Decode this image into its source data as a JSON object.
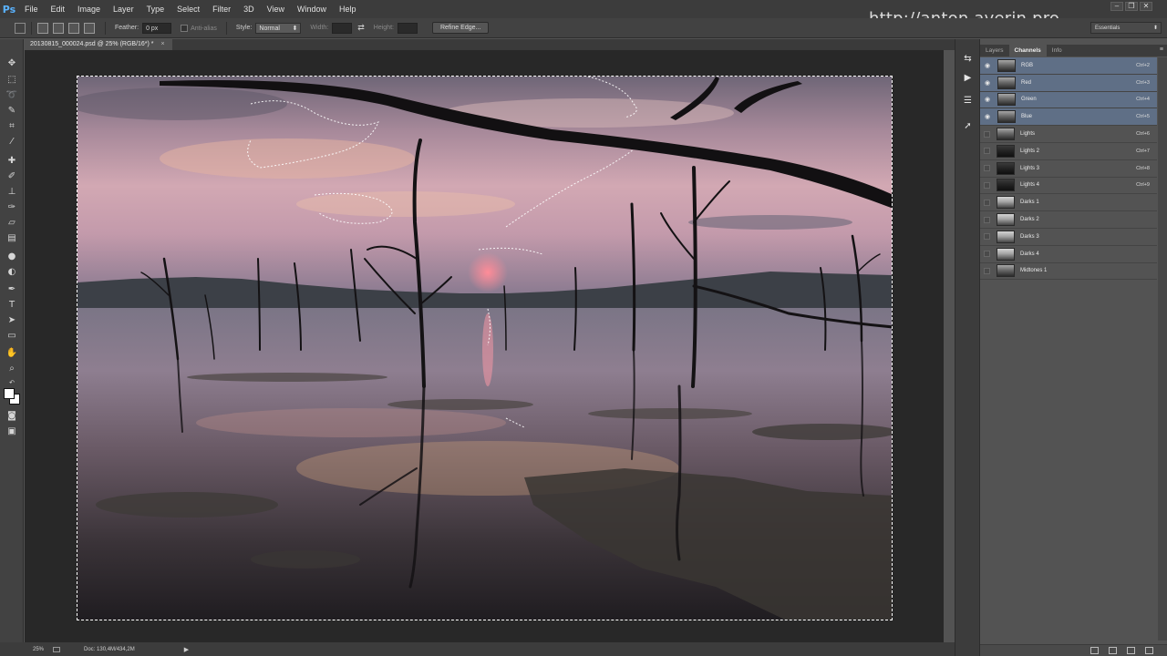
{
  "menubar": {
    "logo": "Ps",
    "items": [
      "File",
      "Edit",
      "Image",
      "Layer",
      "Type",
      "Select",
      "Filter",
      "3D",
      "View",
      "Window",
      "Help"
    ],
    "watermark": "http://anton.averin.pro"
  },
  "options": {
    "feather_label": "Feather:",
    "feather_value": "0 px",
    "anti_alias_label": "Anti-alias",
    "style_label": "Style:",
    "style_value": "Normal",
    "width_label": "Width:",
    "height_label": "Height:",
    "refine_edge_label": "Refine Edge...",
    "workspace": "Essentials"
  },
  "document": {
    "tab_title": "20130815_000024.psd @ 25% (RGB/16*) *",
    "close": "×"
  },
  "status": {
    "zoom": "25%",
    "doc_info": "Doc: 130,4M/434,2M"
  },
  "panel": {
    "tabs": [
      "Layers",
      "Channels",
      "Info"
    ],
    "active_tab": "Channels",
    "channels": [
      {
        "name": "RGB",
        "shortcut": "Ctrl+2",
        "visible": true,
        "selected": true
      },
      {
        "name": "Red",
        "shortcut": "Ctrl+3",
        "visible": true,
        "selected": true
      },
      {
        "name": "Green",
        "shortcut": "Ctrl+4",
        "visible": true,
        "selected": true
      },
      {
        "name": "Blue",
        "shortcut": "Ctrl+5",
        "visible": true,
        "selected": true
      },
      {
        "name": "Lights",
        "shortcut": "Ctrl+6",
        "visible": false,
        "selected": false
      },
      {
        "name": "Lights 2",
        "shortcut": "Ctrl+7",
        "visible": false,
        "selected": false
      },
      {
        "name": "Lights 3",
        "shortcut": "Ctrl+8",
        "visible": false,
        "selected": false
      },
      {
        "name": "Lights 4",
        "shortcut": "Ctrl+9",
        "visible": false,
        "selected": false
      },
      {
        "name": "Darks 1",
        "shortcut": "",
        "visible": false,
        "selected": false
      },
      {
        "name": "Darks 2",
        "shortcut": "",
        "visible": false,
        "selected": false
      },
      {
        "name": "Darks 3",
        "shortcut": "",
        "visible": false,
        "selected": false
      },
      {
        "name": "Darks 4",
        "shortcut": "",
        "visible": false,
        "selected": false
      },
      {
        "name": "Midtones 1",
        "shortcut": "",
        "visible": false,
        "selected": false
      }
    ]
  },
  "colors": {
    "selected_row": "#5f6f86",
    "ps_blue": "#5ab3ff"
  }
}
